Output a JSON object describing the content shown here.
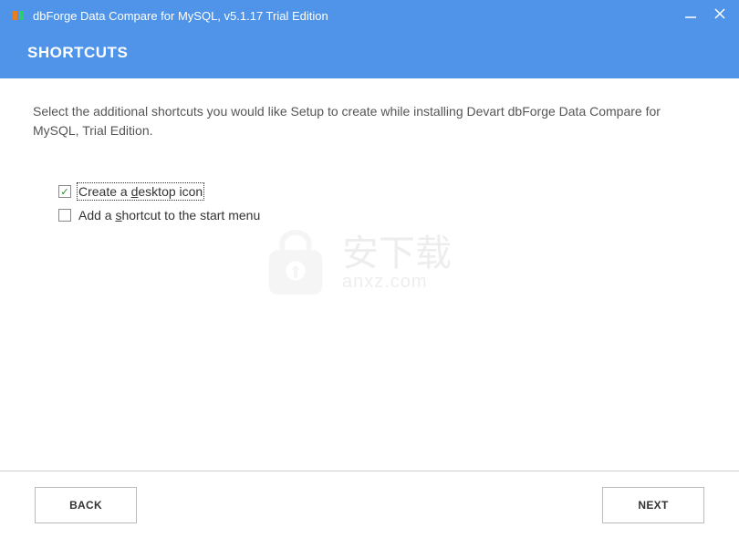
{
  "titlebar": {
    "title": "dbForge Data Compare for MySQL, v5.1.17 Trial Edition"
  },
  "header": {
    "heading": "SHORTCUTS"
  },
  "content": {
    "description": "Select the additional shortcuts you would like Setup to create while installing Devart dbForge Data Compare for MySQL, Trial Edition."
  },
  "options": [
    {
      "checked": true,
      "label_pre": "Create a ",
      "accel": "d",
      "label_post": "esktop icon",
      "focused": true
    },
    {
      "checked": false,
      "label_pre": "Add a ",
      "accel": "s",
      "label_post": "hortcut to the start menu",
      "focused": false
    }
  ],
  "footer": {
    "back": "BACK",
    "next": "NEXT"
  },
  "watermark": {
    "cn": "安下载",
    "en": "anxz.com"
  }
}
